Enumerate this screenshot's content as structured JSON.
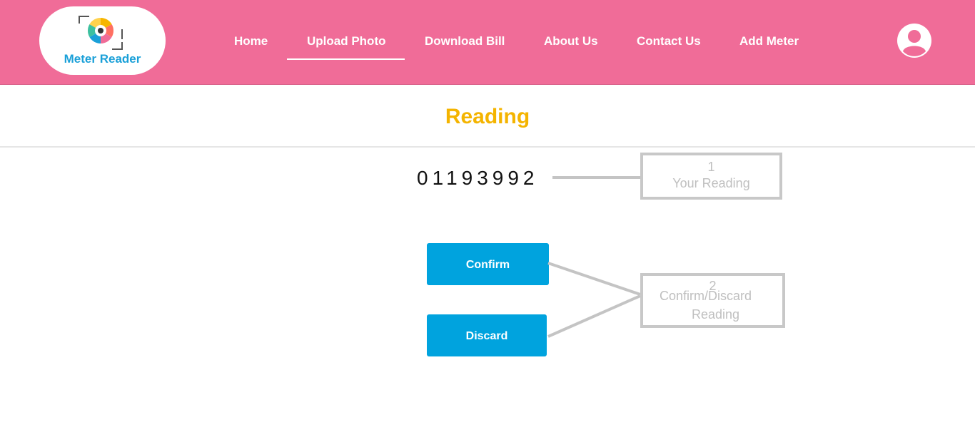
{
  "app": {
    "logo_text": "Meter Reader"
  },
  "nav": {
    "items": [
      {
        "label": "Home"
      },
      {
        "label": "Upload Photo",
        "active": true
      },
      {
        "label": "Download Bill"
      },
      {
        "label": "About Us"
      },
      {
        "label": "Contact Us"
      },
      {
        "label": "Add Meter"
      }
    ]
  },
  "page": {
    "title": "Reading",
    "reading_value": "01193992"
  },
  "actions": {
    "confirm_label": "Confirm",
    "discard_label": "Discard"
  },
  "annotations": {
    "callout1": {
      "number": "1",
      "text": "Your Reading"
    },
    "callout2": {
      "number": "2",
      "line1": "Confirm/Discard",
      "line2": "Reading"
    }
  },
  "colors": {
    "header_bg": "#f06c98",
    "title": "#f4b400",
    "button": "#00a3de",
    "logo_text": "#1aa0d8"
  },
  "icons": {
    "logo": "camera-aperture-icon",
    "profile": "user-avatar-icon"
  }
}
